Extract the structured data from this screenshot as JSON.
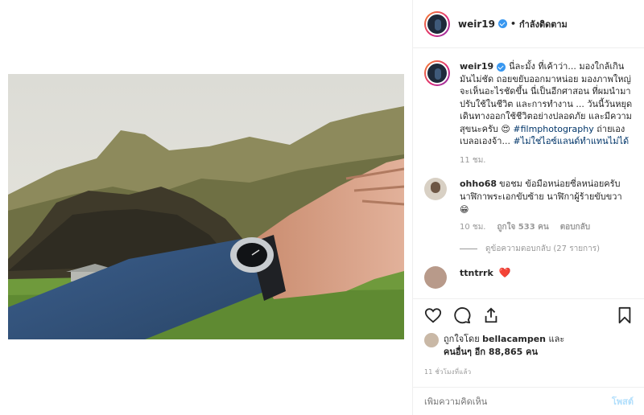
{
  "header": {
    "username": "weir19",
    "separator": "•",
    "follow_status": "กำลังติดตาม"
  },
  "caption": {
    "username": "weir19",
    "text": "นี่ละมั้ง ที่เค้าว่า... มองใกล้เกินมันไม่ชัด ถอยขยับออกมาหน่อย มองภาพใหญ่ จะเห็นอะไรชัดขึ้น นี่เป็นอีกศาสอน ที่ผมนำมาปรับใช้ในชีวิต และการทำงาน ... วันนี้วันหยุด เดินทางออกใช้ชีวิตอย่างปลอดภัย และมีความสุขนะครับ 😍",
    "hashtag1": "#filmphotography",
    "text2": " ถ่ายเองเบลอเองจ้า...",
    "hashtag2": "#ไม่ใช่ไอซ์แลนด์ทำแทนไม่ได้",
    "time": "11 ชม."
  },
  "comments": [
    {
      "username": "ohho68",
      "text": "ขอชม ข้อมือหน่อยซี่ลหน่อยครับ นาฬิกาพระเอกขับซ้าย นาฬิกาผู้ร้ายขับขวา 😁",
      "time": "10 ชม.",
      "likes": "ถูกใจ 533 คน",
      "reply": "ตอบกลับ",
      "view_replies": "ดูข้อความตอบกลับ (27 รายการ)"
    },
    {
      "username": "ttntrrk",
      "text": "❤️"
    }
  ],
  "actions": {
    "liked_by_prefix": "ถูกใจโดย",
    "liked_by_user": "bellacampen",
    "liked_by_and": "และ",
    "others": "คนอื่นๆ อีก 88,865 คน",
    "posted_ago": "11 ชั่วโมงที่แล้ว"
  },
  "add_comment": {
    "placeholder": "เพิ่มความคิดเห็น",
    "post_label": "โพสต์"
  },
  "colors": {
    "link": "#003569",
    "verified": "#3897f0",
    "heart": "#ed4956",
    "post_disabled": "#b2dffc"
  }
}
